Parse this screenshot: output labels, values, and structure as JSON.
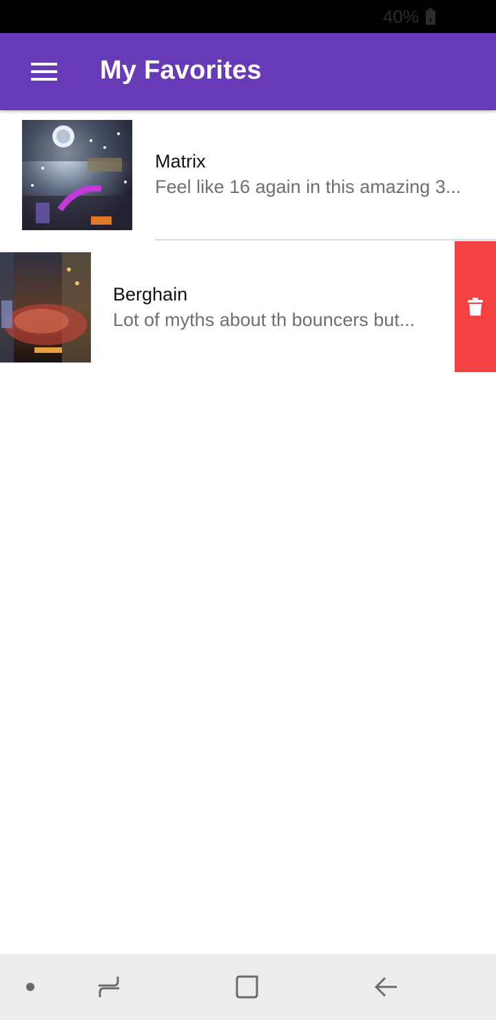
{
  "status_bar": {
    "battery": "40%"
  },
  "app_bar": {
    "title": "My Favorites",
    "color": "#673ab7"
  },
  "favorites": [
    {
      "title": "Matrix",
      "subtitle": "Feel like 16 again in this amazing 3..."
    },
    {
      "title": "Berghain",
      "subtitle": "Lot of myths about th bouncers but..."
    }
  ],
  "swipe_action": {
    "icon": "trash-icon",
    "color": "#f44040"
  },
  "nav_bar": {
    "icons": [
      "dot-icon",
      "recents-icon",
      "home-icon",
      "back-icon"
    ]
  }
}
